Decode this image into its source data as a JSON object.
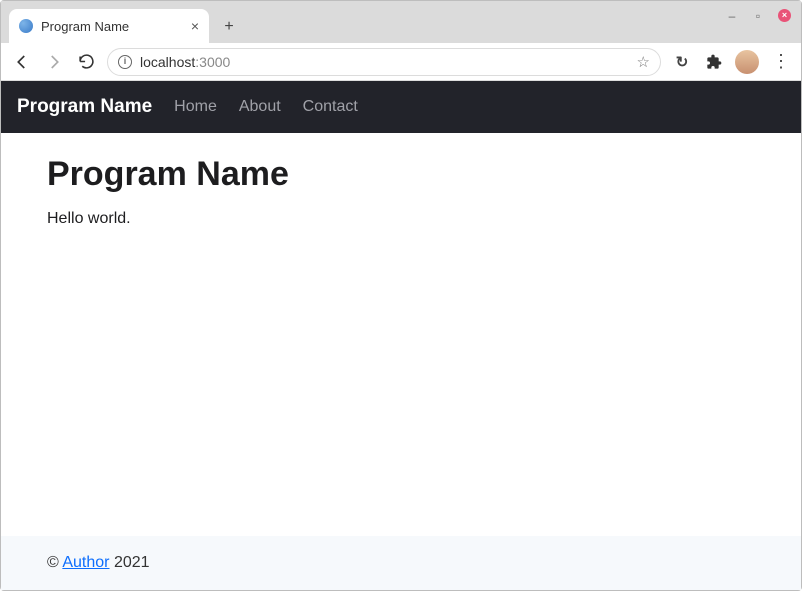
{
  "browser": {
    "tab": {
      "title": "Program Name"
    },
    "url_host": "localhost",
    "url_port": ":3000"
  },
  "navbar": {
    "brand": "Program Name",
    "links": [
      "Home",
      "About",
      "Contact"
    ]
  },
  "main": {
    "heading": "Program Name",
    "body": "Hello world."
  },
  "footer": {
    "copyright_prefix": "© ",
    "author": "Author",
    "year": " 2021"
  }
}
